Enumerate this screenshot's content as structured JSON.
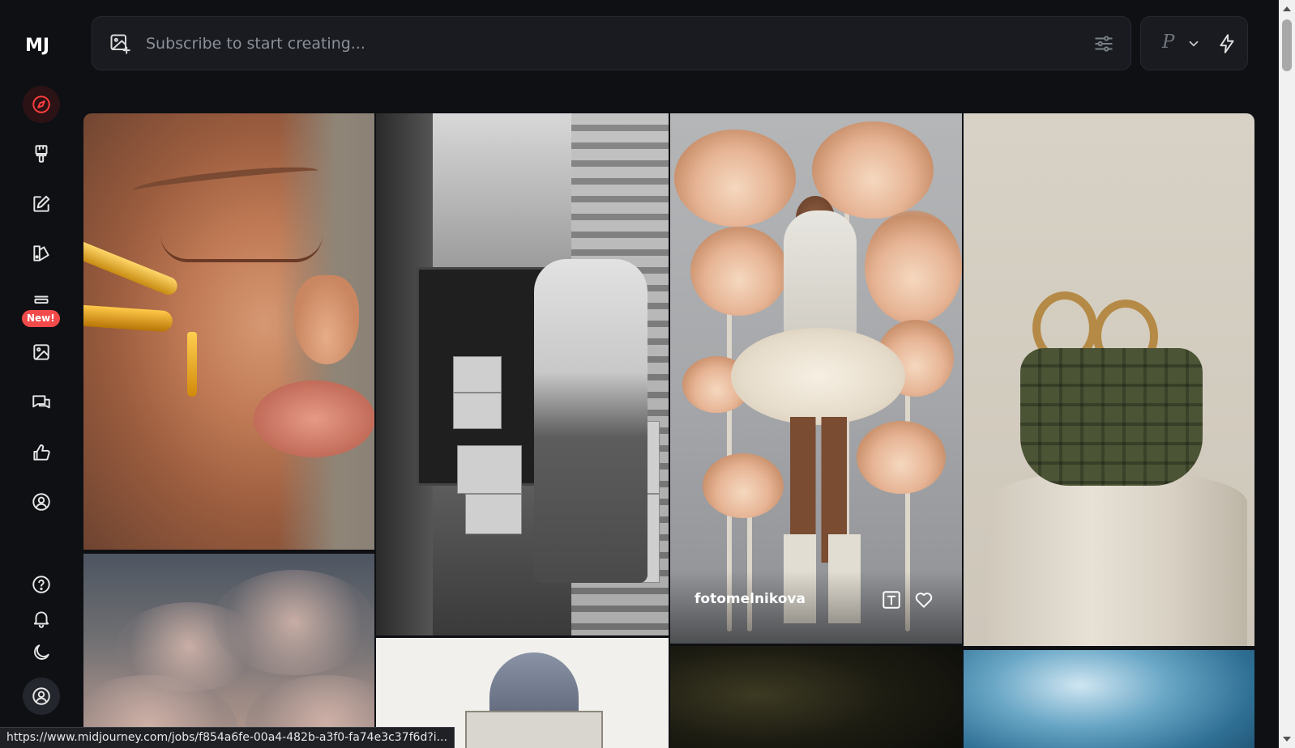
{
  "sidebar": {
    "logo": "MJ",
    "new_badge": "New!",
    "items": [
      {
        "name": "explore",
        "icon": "compass-icon"
      },
      {
        "name": "create",
        "icon": "paintbrush-icon"
      },
      {
        "name": "edit",
        "icon": "edit-icon"
      },
      {
        "name": "personalize",
        "icon": "palette-book-icon"
      },
      {
        "name": "new-feature",
        "icon": "tray-icon"
      },
      {
        "name": "organize",
        "icon": "image-icon"
      },
      {
        "name": "chat",
        "icon": "chat-icon"
      },
      {
        "name": "tasks",
        "icon": "thumbs-up-icon"
      },
      {
        "name": "profile",
        "icon": "user-circle-icon"
      }
    ],
    "bottom": [
      {
        "name": "help",
        "icon": "help-icon"
      },
      {
        "name": "notifications",
        "icon": "bell-icon"
      },
      {
        "name": "theme",
        "icon": "moon-icon"
      },
      {
        "name": "account",
        "icon": "account-icon"
      }
    ],
    "accent_color": "#ff3d3d"
  },
  "prompt": {
    "placeholder": "Subscribe to start creating...",
    "value": ""
  },
  "mode": {
    "label": "P"
  },
  "gallery": {
    "hover_card": {
      "author": "fotomelnikova"
    }
  },
  "status_bar": {
    "url": "https://www.midjourney.com/jobs/f854a6fe-00a4-482b-a3f0-fa74e3c37f6d?i..."
  }
}
